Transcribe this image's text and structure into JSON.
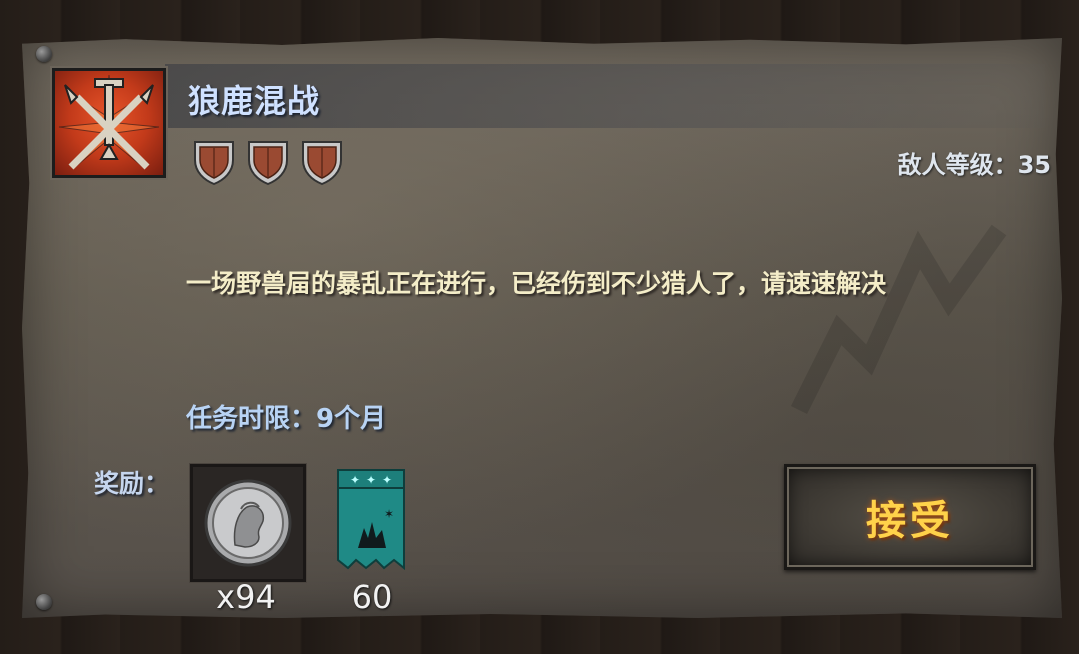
{
  "quest": {
    "title": "狼鹿混战",
    "icon": "crossed-weapons-icon",
    "difficulty_shields": 3,
    "enemy_level_label": "敌人等级：35",
    "description": "一场野兽屇的暴乱正在进行，已经伤到不少猎人了，请速速解决",
    "deadline": "任务时限：9个月"
  },
  "rewards": {
    "label": "奖励：",
    "items": [
      {
        "icon": "silver-coin-icon",
        "quantity": "x94"
      },
      {
        "icon": "moon-banner-icon",
        "quantity": "60"
      }
    ]
  },
  "accept_button": {
    "label": "接受"
  },
  "colors": {
    "title": "#cfe1ff",
    "description": "#f4edc8",
    "accept_text": "#ffd24a",
    "banner_teal": "#1f8a86"
  }
}
